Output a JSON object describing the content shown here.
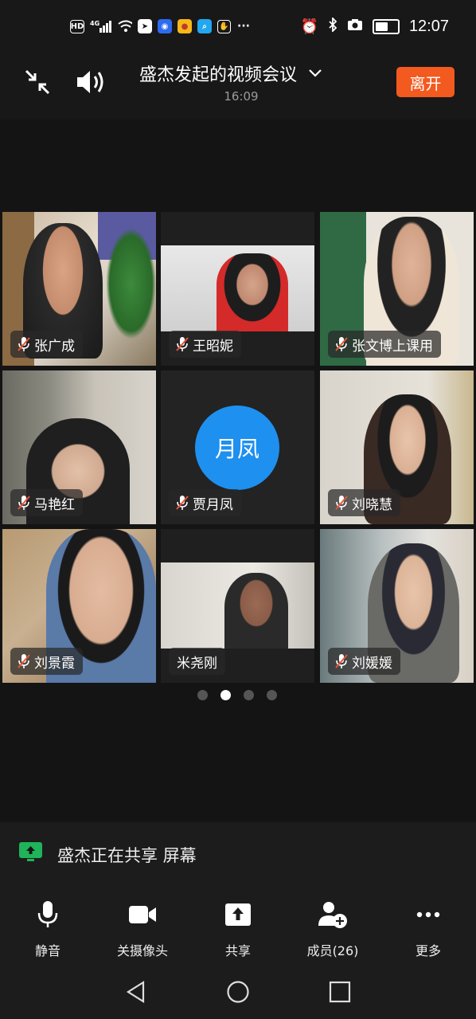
{
  "status_bar": {
    "network": "HD",
    "signal": "4G",
    "time": "12:07",
    "battery_level": 0.7
  },
  "header": {
    "title": "盛杰发起的视频会议",
    "elapsed": "16:09",
    "leave_label": "离开"
  },
  "participants": [
    {
      "name": "张广成",
      "muted": true,
      "video": true
    },
    {
      "name": "王昭妮",
      "muted": true,
      "video": true
    },
    {
      "name": "张文博上课用",
      "muted": true,
      "video": true
    },
    {
      "name": "马艳红",
      "muted": true,
      "video": true
    },
    {
      "name": "贾月凤",
      "muted": true,
      "video": false,
      "avatar_text": "月凤"
    },
    {
      "name": "刘晓慧",
      "muted": true,
      "video": true
    },
    {
      "name": "刘景霞",
      "muted": true,
      "video": true
    },
    {
      "name": "米尧刚",
      "muted": false,
      "video": true
    },
    {
      "name": "刘媛媛",
      "muted": true,
      "video": true
    }
  ],
  "pagination": {
    "pages": 4,
    "current": 2
  },
  "share_banner": {
    "text": "盛杰正在共享 屏幕",
    "icon": "screen-share-icon"
  },
  "toolbar": {
    "mute": "静音",
    "camera": "关摄像头",
    "share": "共享",
    "members": "成员(26)",
    "more": "更多"
  },
  "colors": {
    "background": "#141414",
    "leave_button": "#f25a1f",
    "avatar": "#1e90ef",
    "share_icon": "#1fb35a",
    "muted_mic": "#e8553b"
  }
}
